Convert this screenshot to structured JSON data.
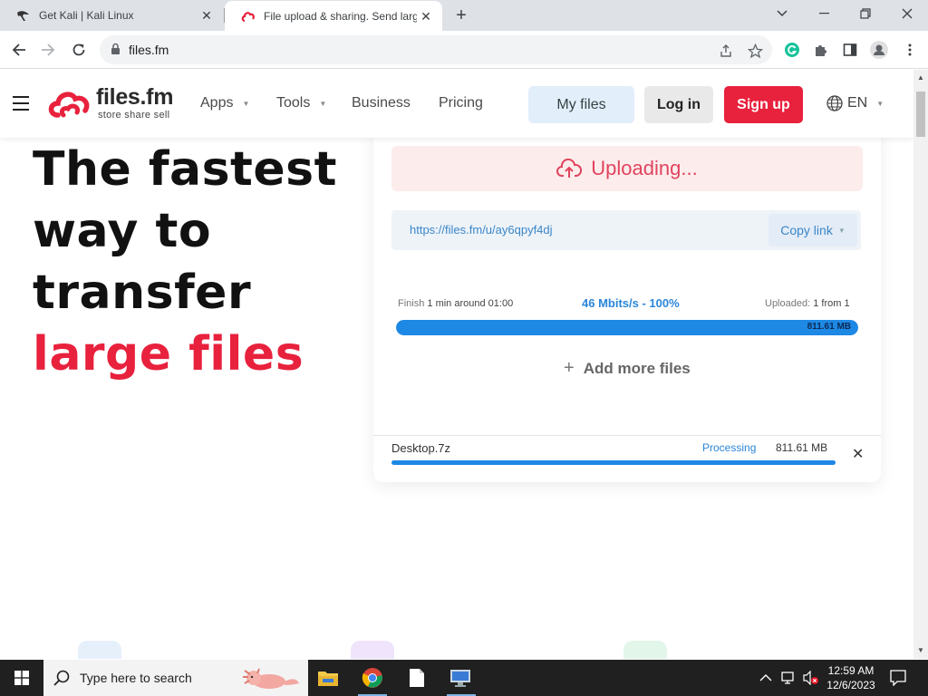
{
  "browser": {
    "tabs": [
      {
        "title": "Get Kali | Kali Linux",
        "active": false
      },
      {
        "title": "File upload & sharing. Send larg",
        "active": true
      }
    ],
    "url": "files.fm"
  },
  "header": {
    "logo_text": "files.fm",
    "logo_tagline": "store  share  sell",
    "nav": [
      "Apps",
      "Tools",
      "Business",
      "Pricing"
    ],
    "my_files": "My files",
    "log_in": "Log in",
    "sign_up": "Sign up",
    "language": "EN"
  },
  "hero": {
    "line1": "The fastest",
    "line2": "way to",
    "line3": "transfer",
    "line4": "large files"
  },
  "upload": {
    "status_title": "Uploading...",
    "share_link": "https://files.fm/u/ay6qpyf4dj",
    "copy_link": "Copy link",
    "finish_label": "Finish",
    "finish_value": "1 min around 01:00",
    "speed": "46 Mbits/s - 100%",
    "uploaded_label": "Uploaded:",
    "uploaded_value": "1 from 1",
    "total_size": "811.61 MB",
    "progress": 1.0,
    "add_more": "Add more files",
    "file": {
      "name": "Desktop.7z",
      "status": "Processing",
      "size": "811.61 MB",
      "progress": 1.0
    }
  },
  "taskbar": {
    "search_placeholder": "Type here to search",
    "time": "12:59 AM",
    "date": "12/6/2023"
  },
  "colors": {
    "brand_red": "#e8213d",
    "accent_blue": "#1e88e5"
  }
}
